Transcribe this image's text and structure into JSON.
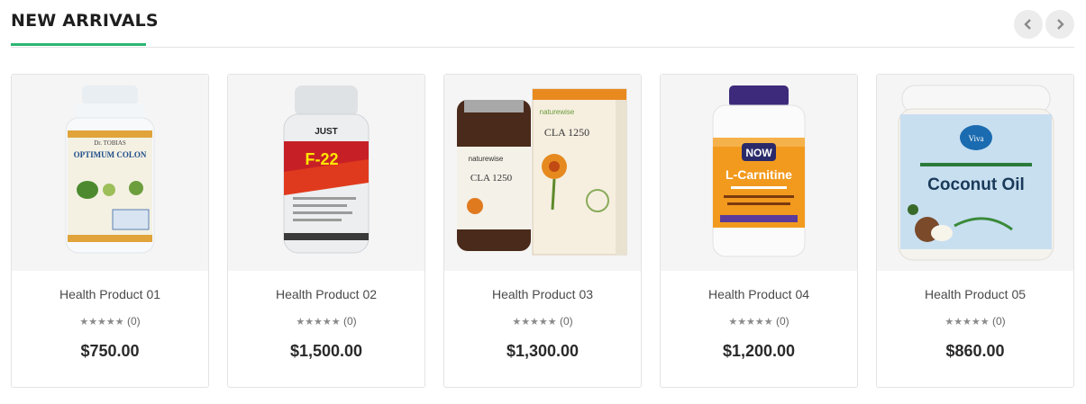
{
  "section": {
    "title": "NEW ARRIVALS",
    "accent_color": "#2bb673",
    "nav": {
      "prev_icon": "chevron-left-icon",
      "next_icon": "chevron-right-icon"
    }
  },
  "products": [
    {
      "name": "Health Product 01",
      "rating_count": "(0)",
      "price": "$750.00",
      "image": "supplement-bottle-optimum-colon",
      "label_top": "Dr. TOBIAS",
      "label_main": "OPTIMUM COLON"
    },
    {
      "name": "Health Product 02",
      "rating_count": "(0)",
      "price": "$1,500.00",
      "image": "supplement-bottle-f22-fat-burner",
      "label_top": "JUST",
      "label_main": "F-22"
    },
    {
      "name": "Health Product 03",
      "rating_count": "(0)",
      "price": "$1,300.00",
      "image": "supplement-bottle-and-box-cla-1250",
      "label_top": "naturewise",
      "label_main": "CLA 1250"
    },
    {
      "name": "Health Product 04",
      "rating_count": "(0)",
      "price": "$1,200.00",
      "image": "supplement-bottle-l-carnitine",
      "label_top": "NOW",
      "label_main": "L-Carnitine"
    },
    {
      "name": "Health Product 05",
      "rating_count": "(0)",
      "price": "$860.00",
      "image": "jar-coconut-oil",
      "label_top": "Viva",
      "label_main": "Coconut Oil"
    }
  ],
  "stars_glyph": "★★★★★"
}
